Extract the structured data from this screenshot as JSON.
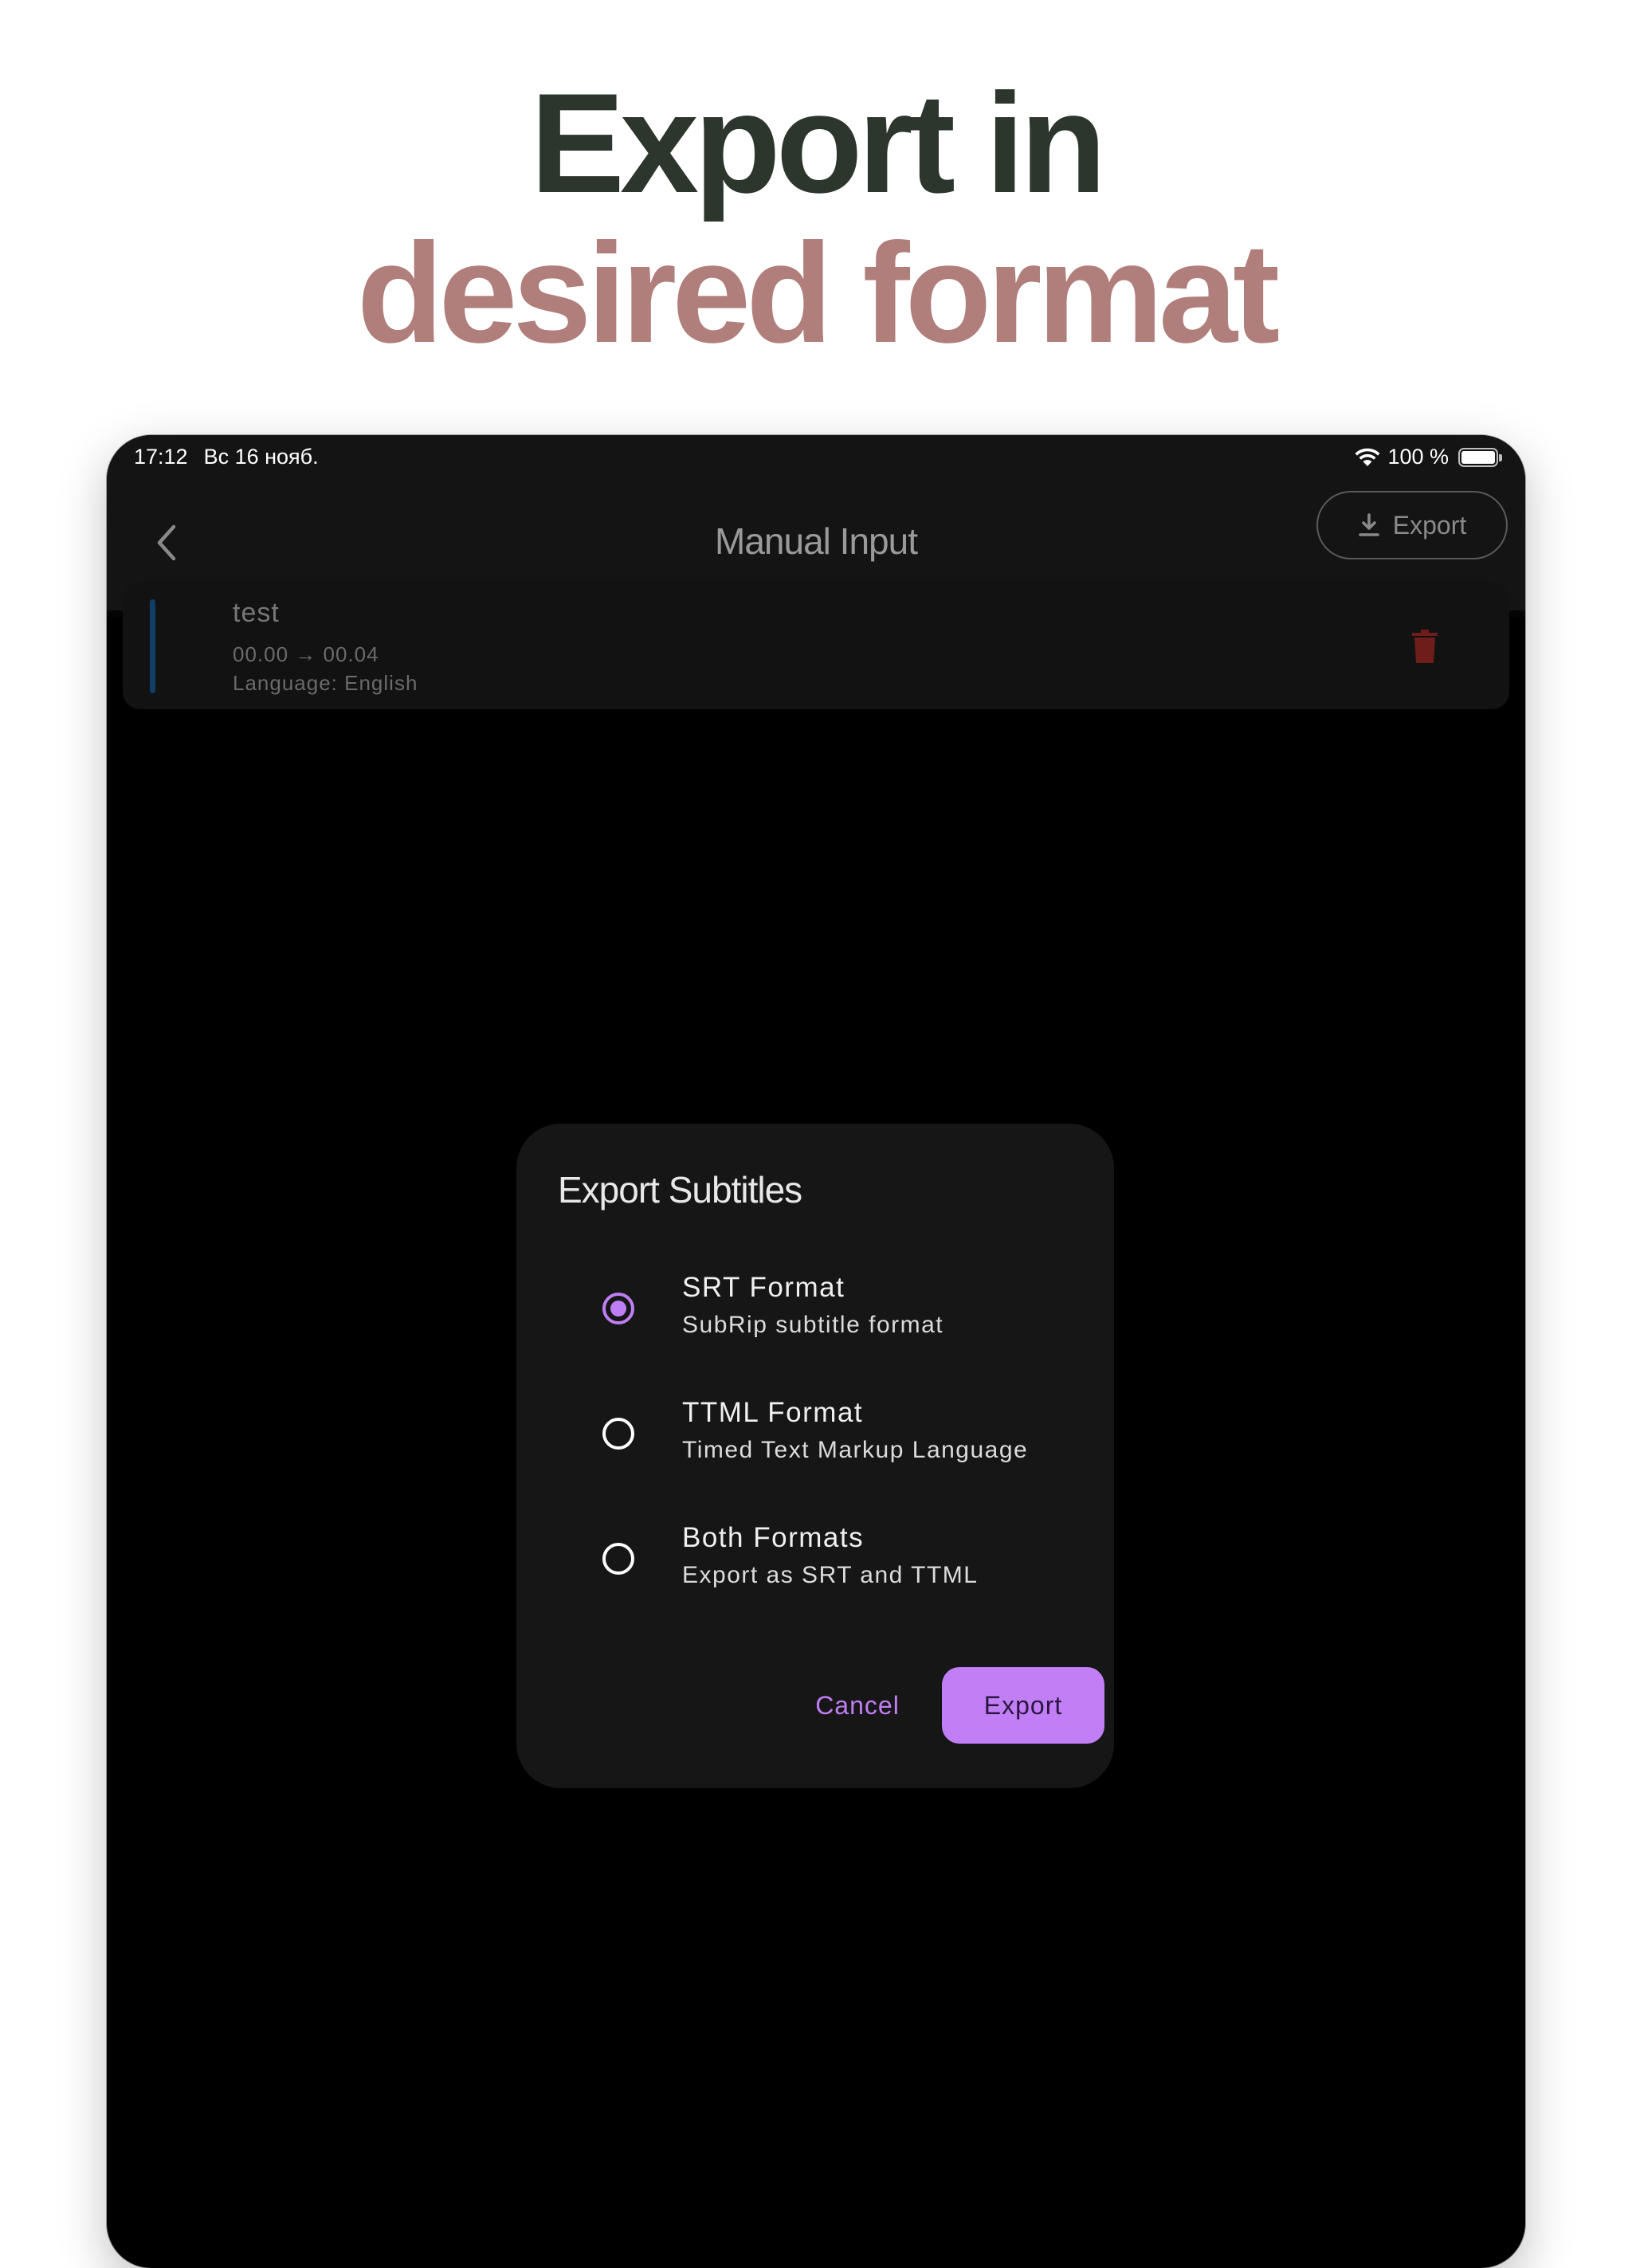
{
  "headline": {
    "line1": "Export in",
    "line2": "desired format",
    "line1_color": "#2c362d",
    "line2_color": "#b07e7b"
  },
  "status_bar": {
    "time": "17:12",
    "date": "Вс 16 нояб.",
    "battery": "100 %"
  },
  "app_bar": {
    "title": "Manual Input",
    "export_label": "Export"
  },
  "subtitle_item": {
    "text": "test",
    "timing": "00.00 → 00.04",
    "language": "Language: English",
    "accent_color": "#0f3f66",
    "delete_color": "#6e1d1a"
  },
  "dialog": {
    "title": "Export Subtitles",
    "options": [
      {
        "label": "SRT Format",
        "description": "SubRip subtitle format",
        "selected": true
      },
      {
        "label": "TTML Format",
        "description": "Timed Text Markup Language",
        "selected": false
      },
      {
        "label": "Both Formats",
        "description": "Export as SRT and TTML",
        "selected": false
      }
    ],
    "cancel_label": "Cancel",
    "export_label": "Export",
    "accent_color": "#c17ef5"
  }
}
